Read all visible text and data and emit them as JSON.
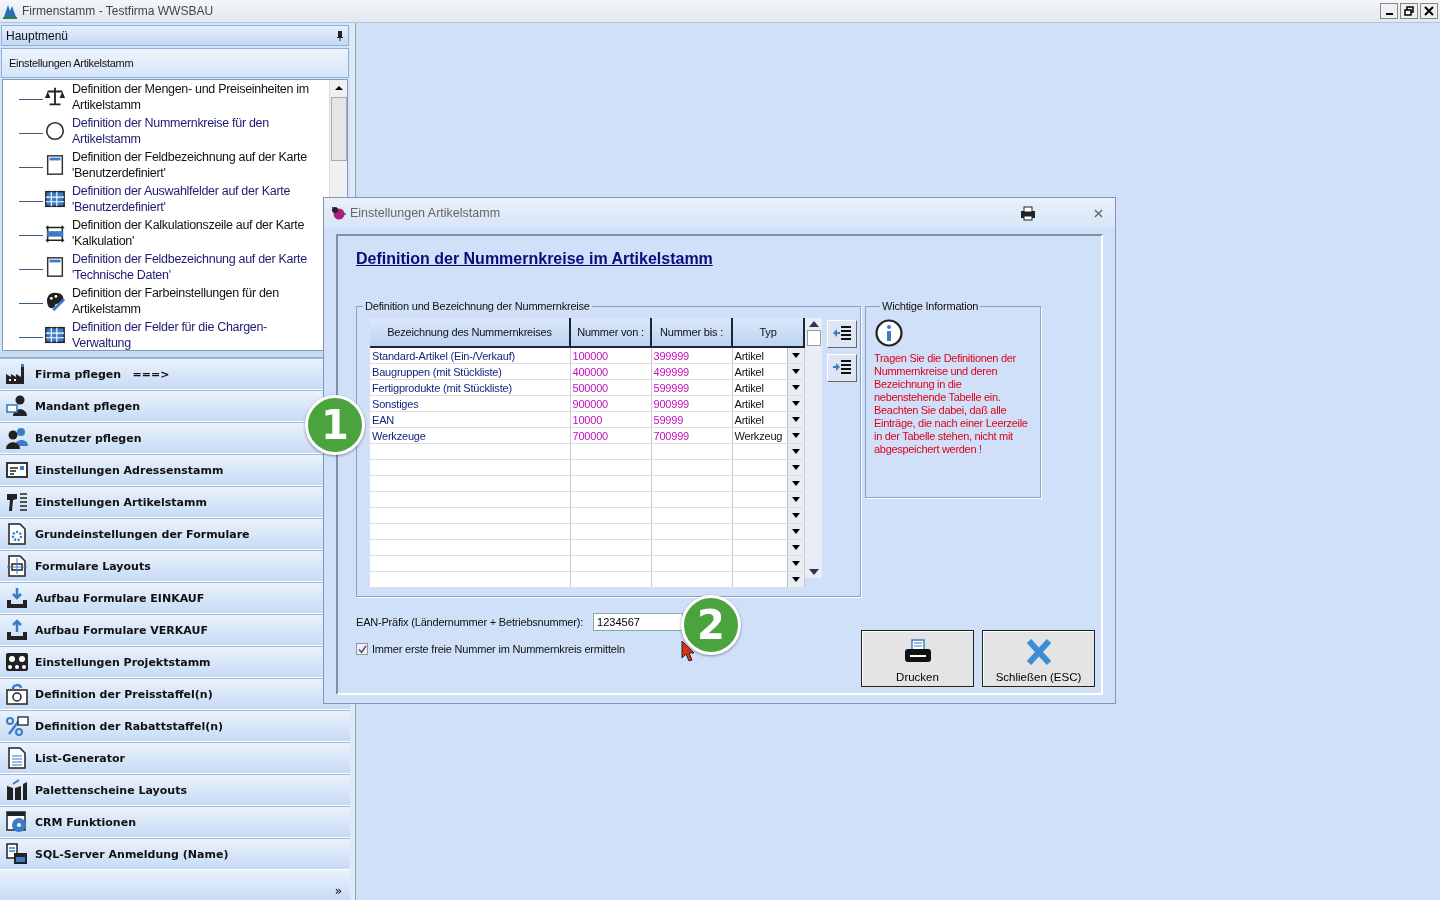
{
  "window": {
    "title": "Firmenstamm - Testfirma WWSBAU"
  },
  "sidebar": {
    "header": "Hauptmenü",
    "section": "Einstellungen Artikelstamm",
    "tree": [
      {
        "label": "Definition der Mengen- und Preiseinheiten im Artikelstamm",
        "color": "#111111"
      },
      {
        "label": "Definition der Nummernkreise für den Artikelstamm",
        "color": "#1c1c70"
      },
      {
        "label": "Definition der Feldbezeichnung auf der Karte 'Benutzerdefiniert'",
        "color": "#111111"
      },
      {
        "label": "Definition der Auswahlfelder auf der Karte 'Benutzerdefiniert'",
        "color": "#1c1c70"
      },
      {
        "label": "Definition der Kalkulationszeile auf der Karte 'Kalkulation'",
        "color": "#111111"
      },
      {
        "label": "Definition der Feldbezeichnung auf der Karte 'Technische Daten'",
        "color": "#1c1c70"
      },
      {
        "label": "Definition der Farbeinstellungen für den Artikelstamm",
        "color": "#111111"
      },
      {
        "label": "Definition der Felder für die Chargen-Verwaltung",
        "color": "#1c1c70"
      }
    ],
    "items": [
      "Firma pflegen   ===>",
      "Mandant pflegen",
      "Benutzer pflegen",
      "Einstellungen Adressenstamm",
      "Einstellungen Artikelstamm",
      "Grundeinstellungen der Formulare",
      "Formulare Layouts",
      "Aufbau Formulare EINKAUF",
      "Aufbau Formulare VERKAUF",
      "Einstellungen Projektstamm",
      "Definition der Preisstaffel(n)",
      "Definition der Rabattstaffel(n)",
      "List-Generator",
      "Palettenscheine Layouts",
      "CRM Funktionen",
      "SQL-Server Anmeldung (Name)"
    ],
    "more": "»"
  },
  "dialog": {
    "title": "Einstellungen Artikelstamm",
    "heading": "Definition der Nummernkreise im Artikelstamm",
    "group": "Definition und Bezeichnung der Nummernkreise",
    "table": {
      "columns": [
        "Bezeichnung des Nummernkreises",
        "Nummer von :",
        "Nummer bis :",
        "Typ"
      ],
      "rows": [
        [
          "Standard-Artikel (Ein-/Verkauf)",
          "100000",
          "399999",
          "Artikel"
        ],
        [
          "Baugruppen (mit Stückliste)",
          "400000",
          "499999",
          "Artikel"
        ],
        [
          "Fertigprodukte (mit Stückliste)",
          "500000",
          "599999",
          "Artikel"
        ],
        [
          "Sonstiges",
          "900000",
          "900999",
          "Artikel"
        ],
        [
          "EAN",
          "10000",
          "59999",
          "Artikel"
        ],
        [
          "Werkzeuge",
          "700000",
          "700999",
          "Werkzeug"
        ]
      ]
    },
    "info": {
      "title": "Wichtige Information",
      "text": "Tragen Sie die Definitionen der Nummernkreise und deren Bezeichnung in die nebenstehende Tabelle ein. Beachten Sie dabei, daß alle Einträge, die nach einer Leerzeile in der Tabelle stehen, nicht mit abgespeichert werden !"
    },
    "ean": {
      "label": "EAN-Präfix (Ländernummer + Betriebsnummer):",
      "value": "1234567"
    },
    "checkbox": {
      "label": "Immer erste freie Nummer im Nummernkreis ermitteln",
      "checked": true
    },
    "buttons": [
      "Drucken",
      "Schließen (ESC)"
    ]
  },
  "callouts": [
    "1",
    "2"
  ]
}
